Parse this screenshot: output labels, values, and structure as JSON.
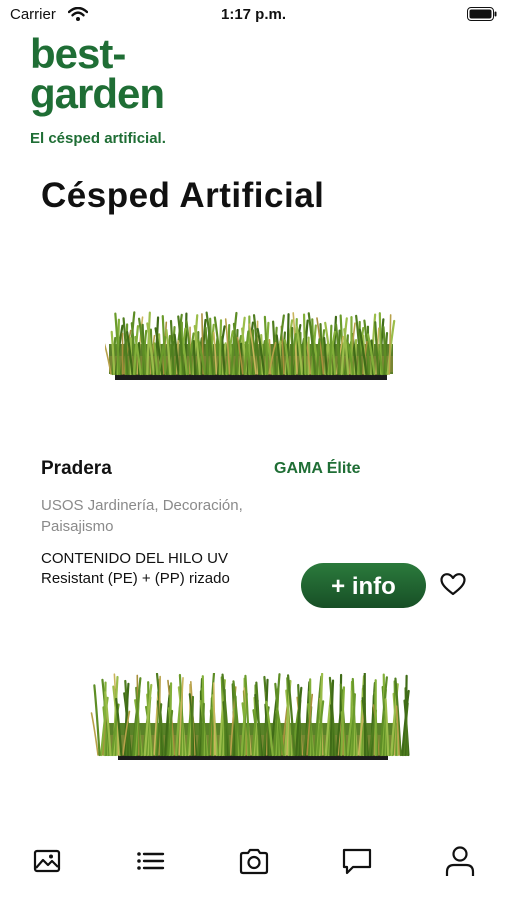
{
  "status_bar": {
    "carrier": "Carrier",
    "time": "1:17 p.m."
  },
  "brand": {
    "line1": "best-",
    "line2": "garden",
    "tagline": "El césped artificial.",
    "color": "#1f6e35"
  },
  "page": {
    "title": "Césped Artificial"
  },
  "product": {
    "name": "Pradera",
    "gama": "GAMA Élite",
    "usos": "USOS Jardinería, Decoración, Paisajismo",
    "contenido": "CONTENIDO DEL HILO UV Resistant (PE) + (PP) rizado",
    "info_button": "+ info"
  },
  "tabbar": {
    "items": [
      {
        "icon": "gallery-icon"
      },
      {
        "icon": "list-icon"
      },
      {
        "icon": "camera-icon"
      },
      {
        "icon": "chat-icon"
      },
      {
        "icon": "profile-icon"
      }
    ]
  }
}
